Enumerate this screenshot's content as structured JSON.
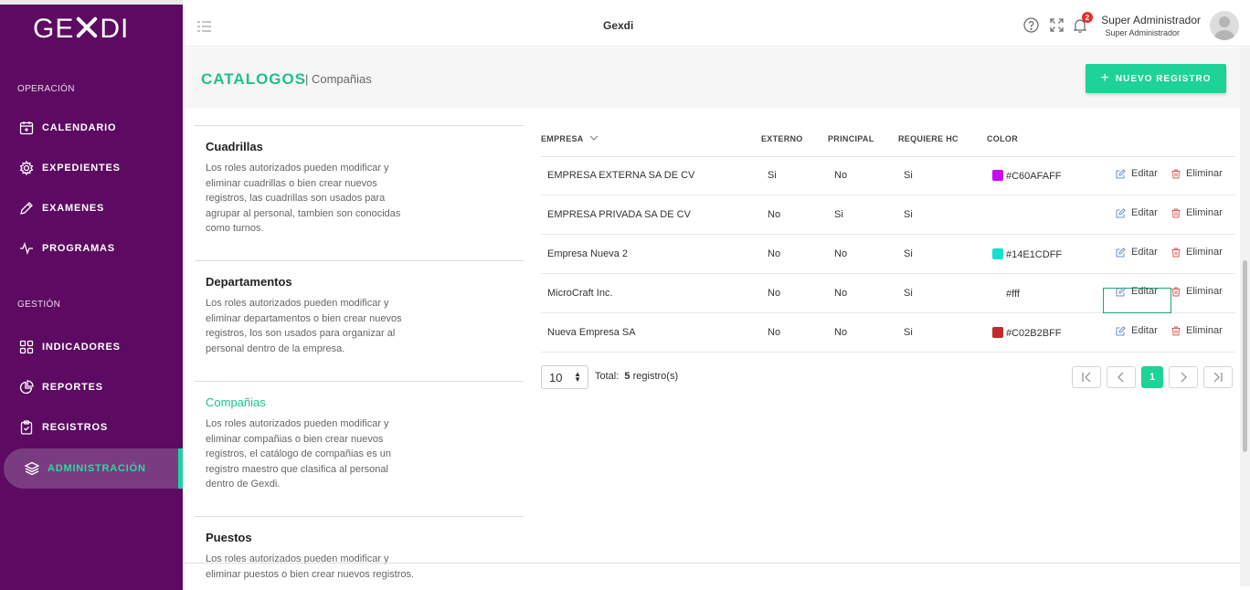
{
  "brand": {
    "logo_left": "GE",
    "logo_right": "DI"
  },
  "sidebar": {
    "section_operacion": "OPERACIÓN",
    "section_gestion": "GESTIÓN",
    "items": [
      {
        "label": "CALENDARIO",
        "icon": "calendar-icon"
      },
      {
        "label": "EXPEDIENTES",
        "icon": "gear-icon"
      },
      {
        "label": "EXAMENES",
        "icon": "pen-icon"
      },
      {
        "label": "PROGRAMAS",
        "icon": "pulse-icon"
      },
      {
        "label": "INDICADORES",
        "icon": "grid-icon"
      },
      {
        "label": "REPORTES",
        "icon": "pie-chart-icon"
      },
      {
        "label": "REGISTROS",
        "icon": "clipboard-icon"
      },
      {
        "label": "ADMINISTRACIÓN",
        "icon": "layers-icon"
      }
    ]
  },
  "header": {
    "title": "Gexdi",
    "notification_count": "2",
    "user_name": "Super Administrador",
    "user_role": "Super Administrador"
  },
  "page": {
    "title": "CATALOGOS",
    "breadcrumb": "| Compañias",
    "new_button": "NUEVO REGISTRO"
  },
  "catalogs": [
    {
      "title": "Cuadrillas",
      "description": "Los roles autorizados pueden modificar y eliminar cuadrillas o bien crear nuevos registros, las cuadrillas son usados para agrupar al personal, tambien son conocidas como turnos."
    },
    {
      "title": "Departamentos",
      "description": "Los roles autorizados pueden modificar y eliminar departamentos o bien crear nuevos registros, los son usados para organizar al personal dentro de la empresa."
    },
    {
      "title": "Compañias",
      "description": "Los roles autorizados pueden modificar y eliminar compañias o bien crear nuevos registros, el catálogo de compañias es un registro maestro que clasifica al personal dentro de Gexdi."
    },
    {
      "title": "Puestos",
      "description": "Los roles autorizados pueden modificar y eliminar puestos o bien crear nuevos registros."
    }
  ],
  "table": {
    "columns": {
      "empresa": "EMPRESA",
      "externo": "EXTERNO",
      "principal": "PRINCIPAL",
      "requiere_hc": "REQUIERE HC",
      "color": "COLOR"
    },
    "edit_label": "Editar",
    "delete_label": "Eliminar",
    "rows": [
      {
        "empresa": "EMPRESA EXTERNA SA DE CV",
        "externo": "Si",
        "principal": "No",
        "requiere_hc": "Si",
        "color": "#C60AFAFF",
        "swatch": "#C60AFA"
      },
      {
        "empresa": "EMPRESA PRIVADA SA DE CV",
        "externo": "No",
        "principal": "Si",
        "requiere_hc": "Si",
        "color": "",
        "swatch": ""
      },
      {
        "empresa": "Empresa Nueva 2",
        "externo": "No",
        "principal": "No",
        "requiere_hc": "Si",
        "color": "#14E1CDFF",
        "swatch": "#14E1CD"
      },
      {
        "empresa": "MicroCraft Inc.",
        "externo": "No",
        "principal": "No",
        "requiere_hc": "Si",
        "color": "#fff",
        "swatch": "#ffffff"
      },
      {
        "empresa": "Nueva Empresa SA",
        "externo": "No",
        "principal": "No",
        "requiere_hc": "Si",
        "color": "#C02B2BFF",
        "swatch": "#C02B2B"
      }
    ]
  },
  "pagination": {
    "page_size": "10",
    "total_label": "Total:",
    "total_count": "5",
    "total_suffix": "registro(s)",
    "current_page": "1"
  },
  "colors": {
    "sidebar": "#5c0a62",
    "accent": "#1dd397"
  }
}
